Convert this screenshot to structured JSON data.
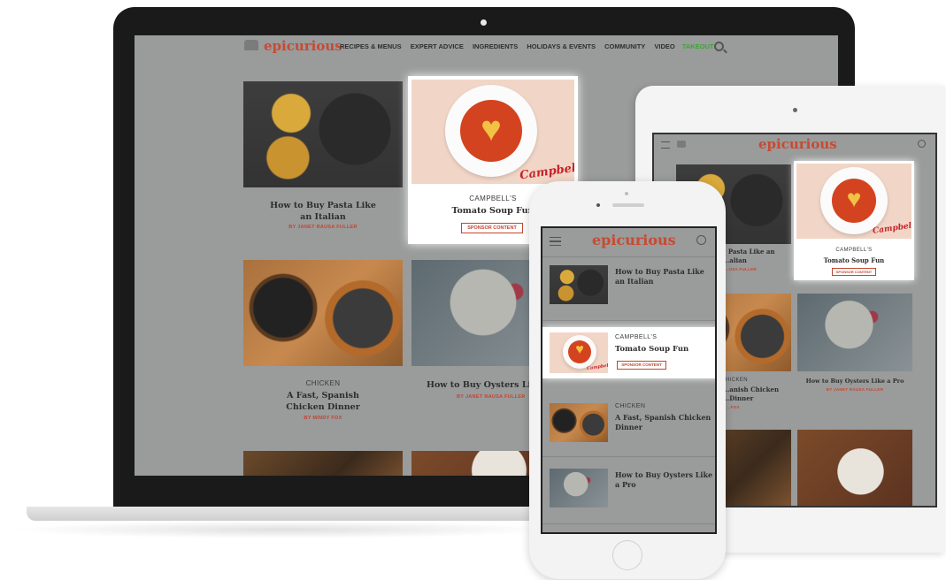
{
  "brand": {
    "logo": "epicurious"
  },
  "laptop": {
    "nav": [
      "RECIPES & MENUS",
      "EXPERT ADVICE",
      "INGREDIENTS",
      "HOLIDAYS & EVENTS",
      "COMMUNITY",
      "VIDEO"
    ],
    "takeout": "TAKEOUT!",
    "cards": [
      {
        "title": "How to Buy Pasta Like an Italian",
        "byline": "BY JANET RAUSA FULLER"
      },
      {
        "kicker": "CAMPBELL'S",
        "title": "Tomato Soup Fun",
        "sponsor": "SPONSOR CONTENT",
        "brand_script": "Campbell's"
      },
      {
        "kicker": "CHICKEN",
        "title": "A Fast, Spanish Chicken Dinner",
        "byline": "BY MINDY FOX"
      },
      {
        "title": "How to Buy Oysters Like a",
        "byline": "BY JANET RAUSA FULLER"
      }
    ]
  },
  "tablet": {
    "cards": [
      {
        "title": "...y Pasta Like an",
        "subtitle": "...alian",
        "byline": "...USA FULLER"
      },
      {
        "kicker": "CAMPBELL'S",
        "title": "Tomato Soup Fun",
        "sponsor": "SPONSOR CONTENT",
        "brand_script": "Campbell's"
      },
      {
        "kicker": "...CHICKEN",
        "title": "...anish Chicken",
        "subtitle": "...Dinner",
        "byline": "...FOX"
      },
      {
        "title": "How to Buy Oysters Like a Pro",
        "byline": "BY JANET RAUSA FULLER"
      }
    ]
  },
  "phone": {
    "items": [
      {
        "title": "How to Buy Pasta Like an Italian"
      },
      {
        "kicker": "CAMPBELL'S",
        "title": "Tomato Soup Fun",
        "sponsor": "SPONSOR CONTENT",
        "brand_script": "Campbell's"
      },
      {
        "kicker": "CHICKEN",
        "title": "A Fast, Spanish Chicken Dinner"
      },
      {
        "title": "How to Buy Oysters Like a Pro"
      }
    ]
  },
  "colors": {
    "brand": "#c84a32",
    "takeout": "#3fa23a",
    "overlay": "#9a9b9b"
  }
}
